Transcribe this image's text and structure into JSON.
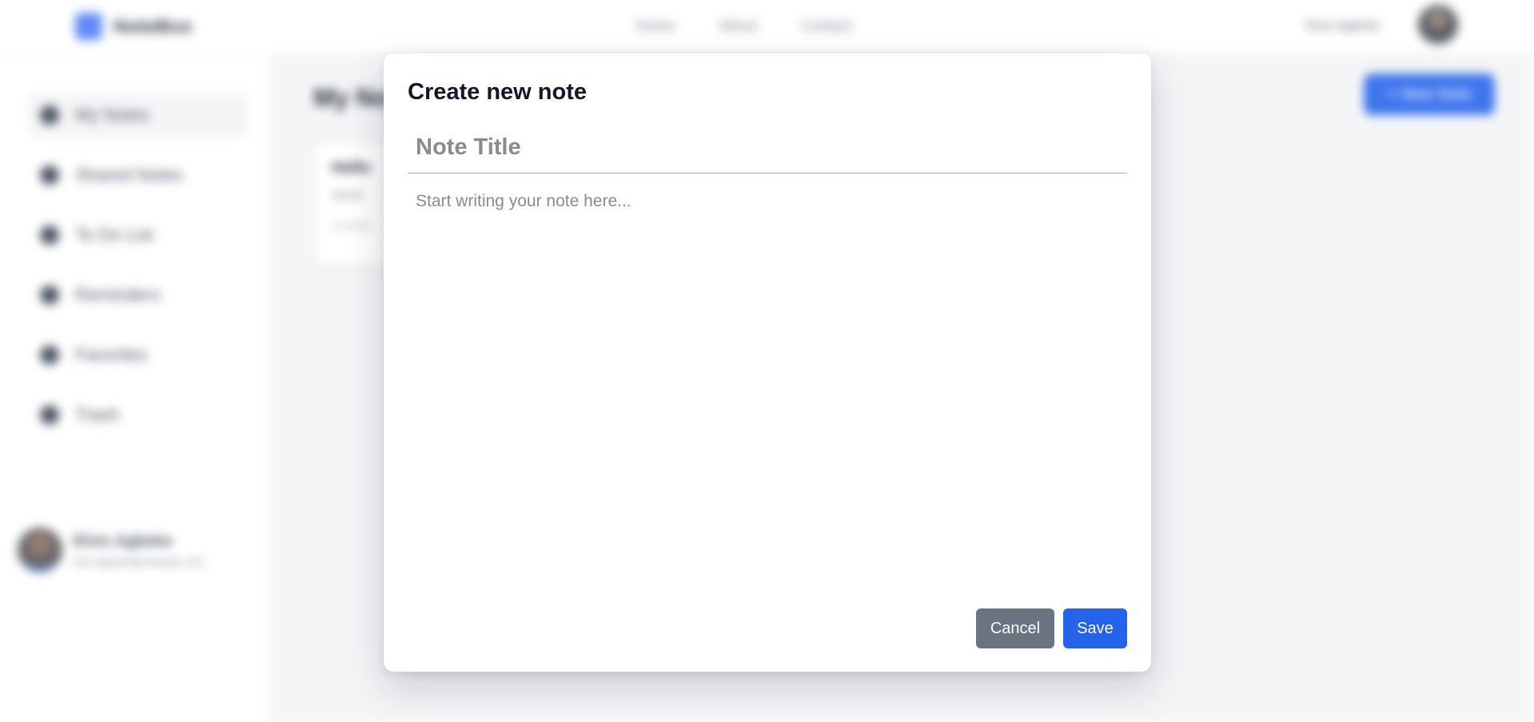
{
  "app": {
    "brand": "NoteBox",
    "nav": [
      "Home",
      "About",
      "Contact"
    ],
    "user_name": "Elvis Agbeke"
  },
  "sidebar": {
    "items": [
      {
        "label": "My Notes",
        "icon": "document-icon"
      },
      {
        "label": "Shared Notes",
        "icon": "share-icon"
      },
      {
        "label": "To Do List",
        "icon": "checklist-icon"
      },
      {
        "label": "Reminders",
        "icon": "bell-icon"
      },
      {
        "label": "Favorites",
        "icon": "star-icon"
      },
      {
        "label": "Trash",
        "icon": "trash-icon"
      }
    ],
    "user": {
      "name": "Elvis Agbeke",
      "email": "elvis.agbeke@example.com"
    }
  },
  "main": {
    "title": "My Notes",
    "new_note_label": "+ New Note",
    "note_card": {
      "title": "Hello",
      "body": "World",
      "date": "1/1/2024"
    }
  },
  "modal": {
    "title": "Create new note",
    "title_placeholder": "Note Title",
    "body_placeholder": "Start writing your note here...",
    "cancel_label": "Cancel",
    "save_label": "Save"
  },
  "colors": {
    "primary": "#2563eb",
    "secondary": "#6b7280",
    "background": "#f3f4f6",
    "placeholder": "#8b8b8b"
  }
}
